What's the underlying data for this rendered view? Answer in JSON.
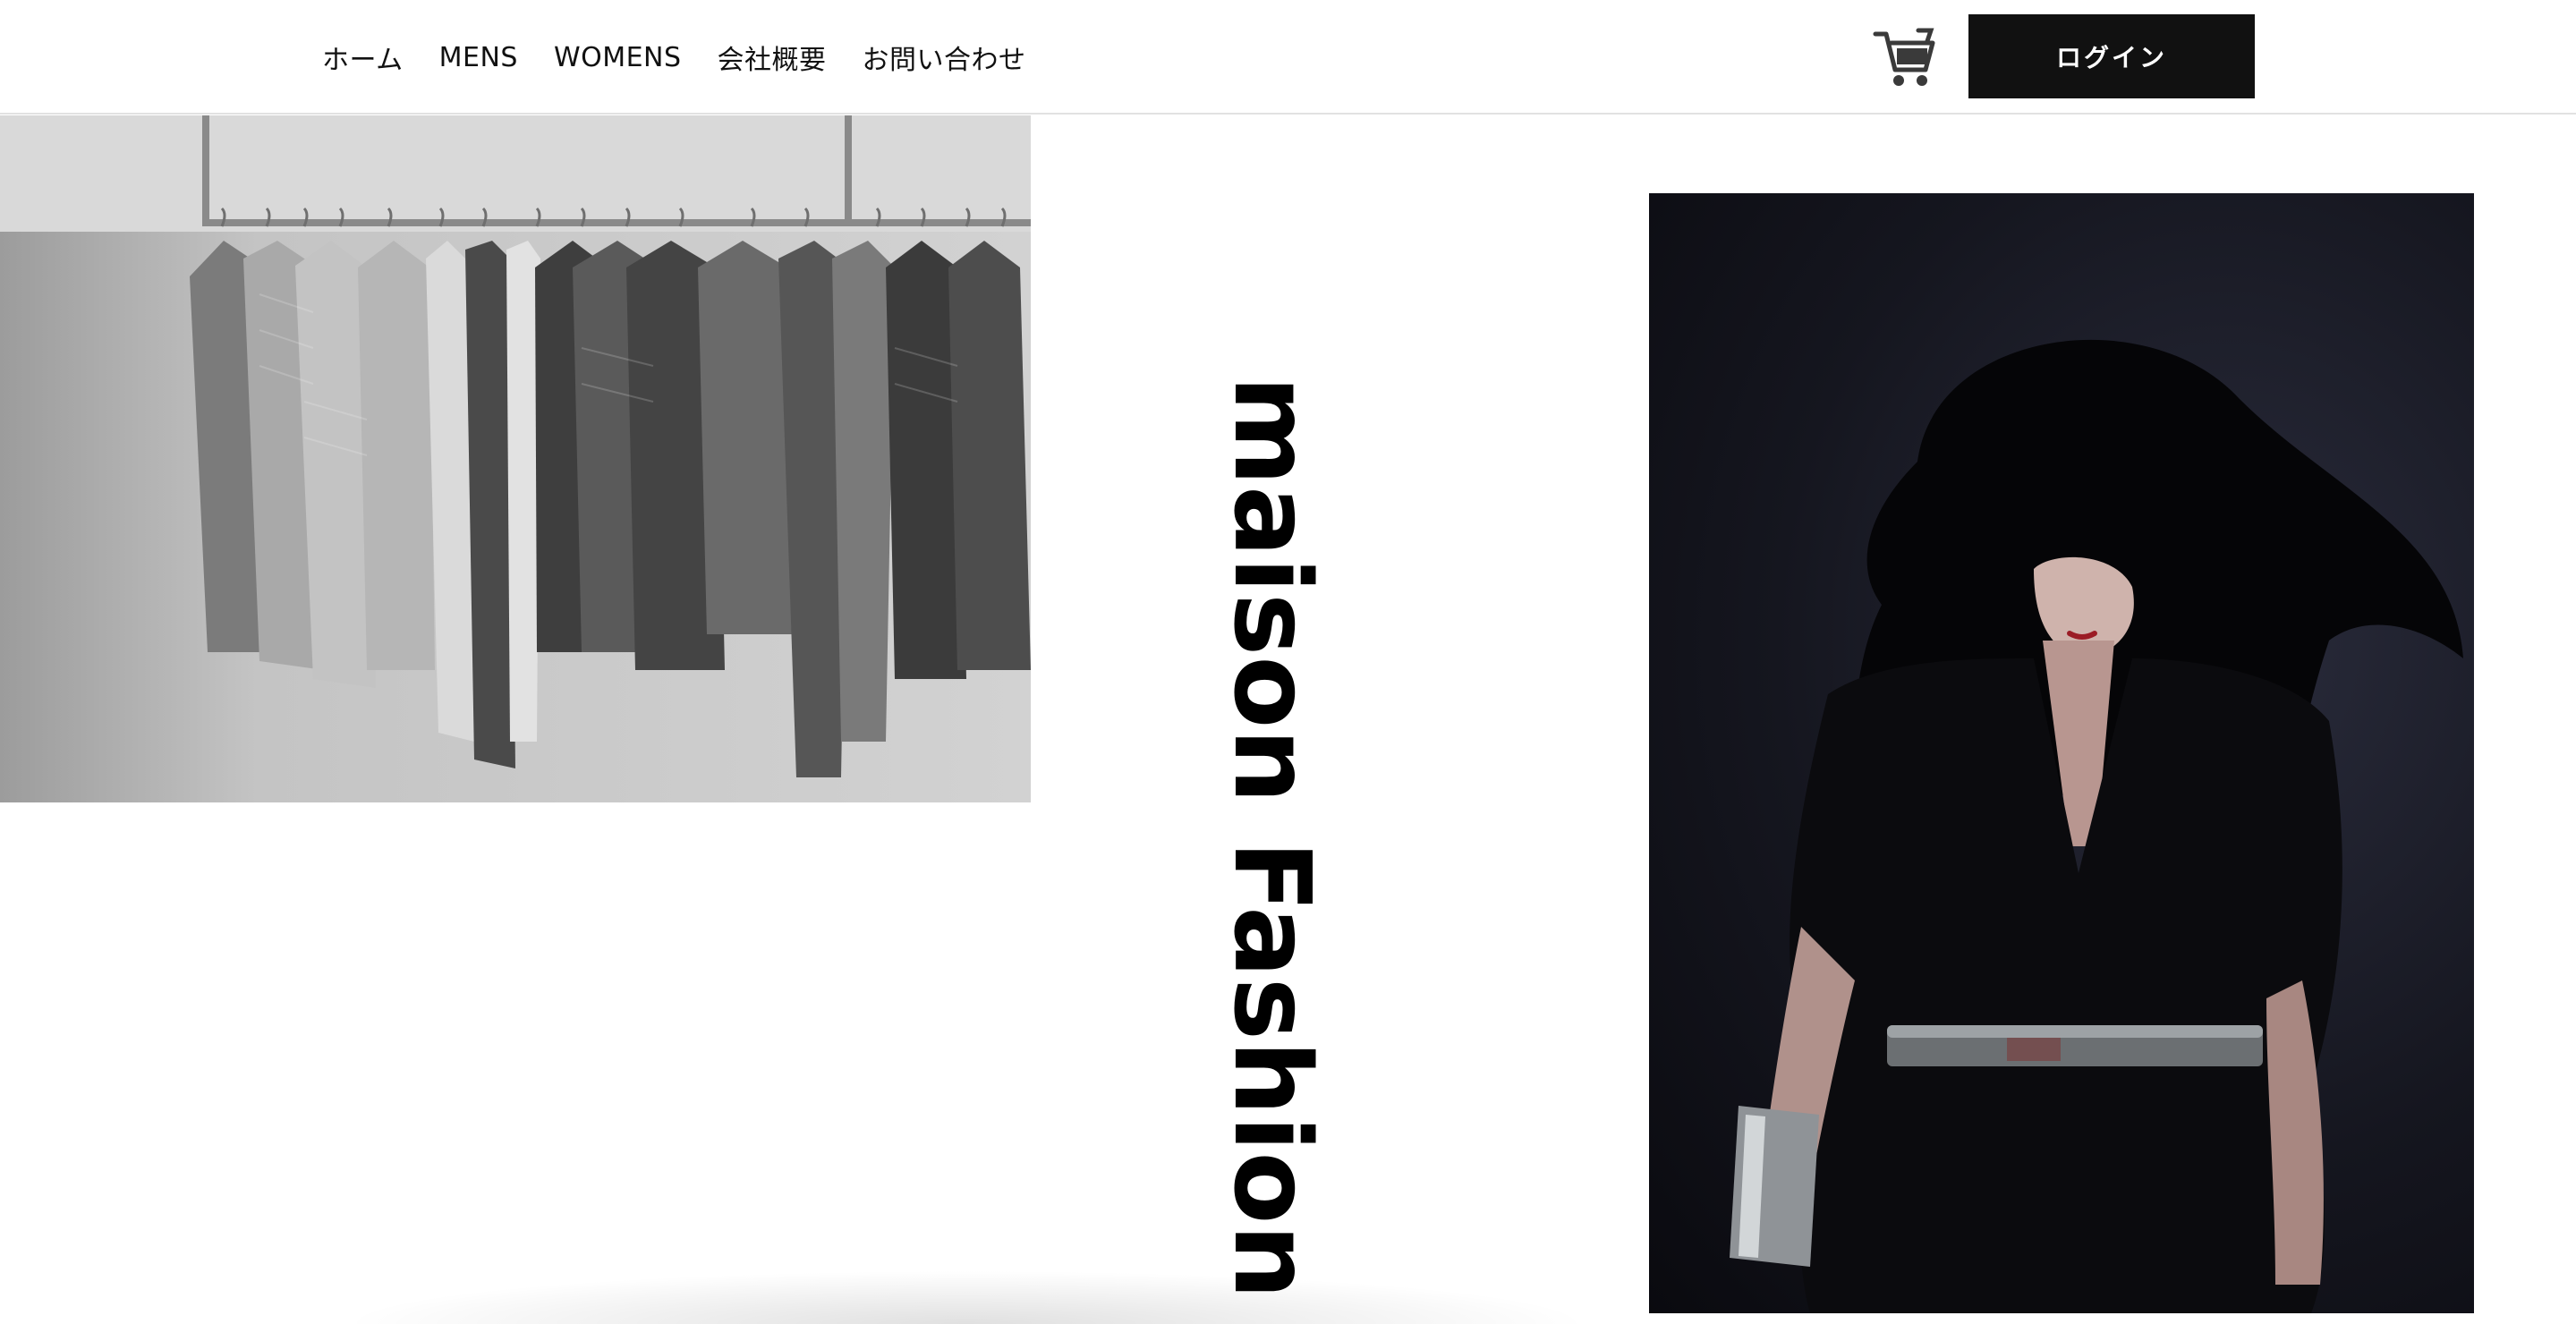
{
  "header": {
    "nav": {
      "home": "ホーム",
      "mens": "MENS",
      "womens": "WOMENS",
      "about": "会社概要",
      "contact": "お問い合わせ"
    },
    "cart_icon": "cart-icon",
    "login_label": "ログイン"
  },
  "hero": {
    "brand": "maison Fashion",
    "images": [
      "clothing-rack-photo",
      "model-portrait-photo"
    ]
  },
  "colors": {
    "accent": "#111111",
    "background": "#ffffff",
    "header_border": "#e2e2e2"
  }
}
